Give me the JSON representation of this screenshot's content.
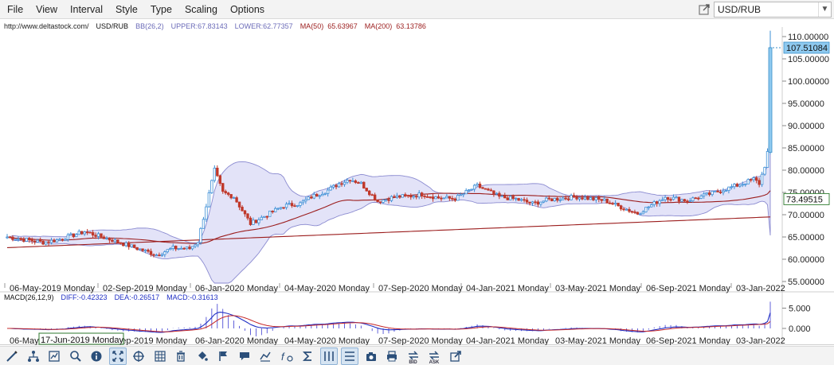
{
  "menu": [
    "File",
    "View",
    "Interval",
    "Style",
    "Type",
    "Scaling",
    "Options"
  ],
  "symbol_select": "USD/RUB",
  "legend": {
    "url": "http://www.deltastock.com/",
    "symbol": "USD/RUB",
    "bb": "BB(26,2)",
    "upper": "UPPER:67.83143",
    "lower": "LOWER:62.77357",
    "ma50": "MA(50)",
    "ma50_val": "65.63967",
    "ma200": "MA(200)",
    "ma200_val": "63.13786"
  },
  "macd_legend": {
    "name": "MACD(26,12,9)",
    "diff": "DIFF:-0.42323",
    "dea": "DEA:-0.26517",
    "macd": "MACD:-0.31613"
  },
  "price_labels": [
    "110.00000",
    "105.00000",
    "100.00000",
    "95.00000",
    "90.00000",
    "85.00000",
    "80.00000",
    "75.00000",
    "70.00000",
    "65.00000",
    "60.00000",
    "55.00000"
  ],
  "price_badge": "107.51084",
  "ma_badge": "73.49515",
  "macd_labels": [
    "5.000",
    "0.000"
  ],
  "date_labels": [
    "06-May-2019 Monday",
    "02-Sep-2019 Monday",
    "06-Jan-2020 Monday",
    "04-May-2020 Monday",
    "07-Sep-2020 Monday",
    "04-Jan-2021 Monday",
    "03-May-2021 Monday",
    "06-Sep-2021 Monday",
    "03-Jan-2022"
  ],
  "bottom_date_labels": [
    "06-May",
    "02-Sep-2019 Monday",
    "06-Jan-2020 Monday",
    "04-May-2020 Monday",
    "07-Sep-2020 Monday",
    "04-Jan-2021 Monday",
    "03-May-2021 Monday",
    "06-Sep-2021 Monday",
    "03-Jan-2022"
  ],
  "crosshair_date": "17-Jun-2019 Monday",
  "colors": {
    "up": "#3d8fd6",
    "down": "#c0392b",
    "band_fill": "#d9d9f5",
    "band_line": "#8a8ad0",
    "ma_line": "#9b1c1c",
    "macd_line": "#1f2fc4",
    "signal_line": "#c62828",
    "badge": "#8ec9ef"
  },
  "toolbar": [
    {
      "name": "draw-line-icon",
      "active": false
    },
    {
      "name": "tree-icon",
      "active": false
    },
    {
      "name": "chart-icon",
      "active": false
    },
    {
      "name": "zoom-icon",
      "active": false
    },
    {
      "name": "info-icon",
      "active": false
    },
    {
      "name": "autoscale-icon",
      "active": true
    },
    {
      "name": "crosshair-icon",
      "active": false
    },
    {
      "name": "grid-icon",
      "active": false
    },
    {
      "name": "trash-icon",
      "active": false
    },
    {
      "name": "fill-icon",
      "active": false
    },
    {
      "name": "flag-icon",
      "active": false
    },
    {
      "name": "chat-icon",
      "active": false
    },
    {
      "name": "indicator-icon",
      "active": false
    },
    {
      "name": "function-icon",
      "active": false
    },
    {
      "name": "sigma-icon",
      "active": false
    },
    {
      "name": "vline-icon",
      "active": true
    },
    {
      "name": "hline-icon",
      "active": true
    },
    {
      "name": "camera-icon",
      "active": false
    },
    {
      "name": "print-icon",
      "active": false
    },
    {
      "name": "bid-icon",
      "active": false,
      "cap": "BID"
    },
    {
      "name": "ask-icon",
      "active": false,
      "cap": "ASK"
    },
    {
      "name": "popout-icon",
      "active": false
    }
  ]
}
